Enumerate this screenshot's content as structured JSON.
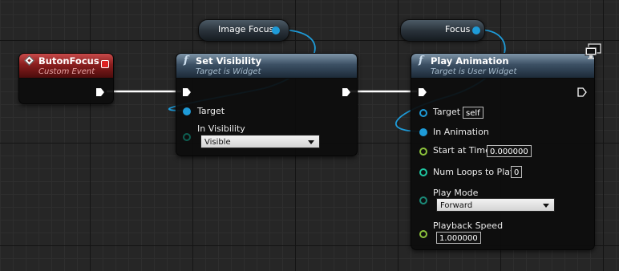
{
  "colors": {
    "exec_wire": "#ffffff",
    "object_wire": "#1e9bd8",
    "event_header": "#8a1e1e",
    "function_header": "#3c5064"
  },
  "reroutes": {
    "image_focus": {
      "label": "Image Focus"
    },
    "focus": {
      "label": "Focus"
    }
  },
  "event_node": {
    "title": "ButonFocus",
    "subtitle": "Custom Event",
    "icon": "event-diamond-icon"
  },
  "set_visibility": {
    "title": "Set Visibility",
    "subtitle": "Target is Widget",
    "icon": "function-icon",
    "target_label": "Target",
    "in_visibility_label": "In Visibility",
    "in_visibility_value": "Visible"
  },
  "play_animation": {
    "title": "Play Animation",
    "subtitle": "Target is User Widget",
    "icon": "function-icon",
    "target_label": "Target",
    "target_value": "self",
    "in_animation_label": "In Animation",
    "start_at_time_label": "Start at Time",
    "start_at_time_value": "0.000000",
    "num_loops_label": "Num Loops to Play",
    "num_loops_value": "0",
    "play_mode_label": "Play Mode",
    "play_mode_value": "Forward",
    "playback_speed_label": "Playback Speed",
    "playback_speed_value": "1.000000"
  },
  "badges": {
    "monitor": "monitor-icon"
  }
}
